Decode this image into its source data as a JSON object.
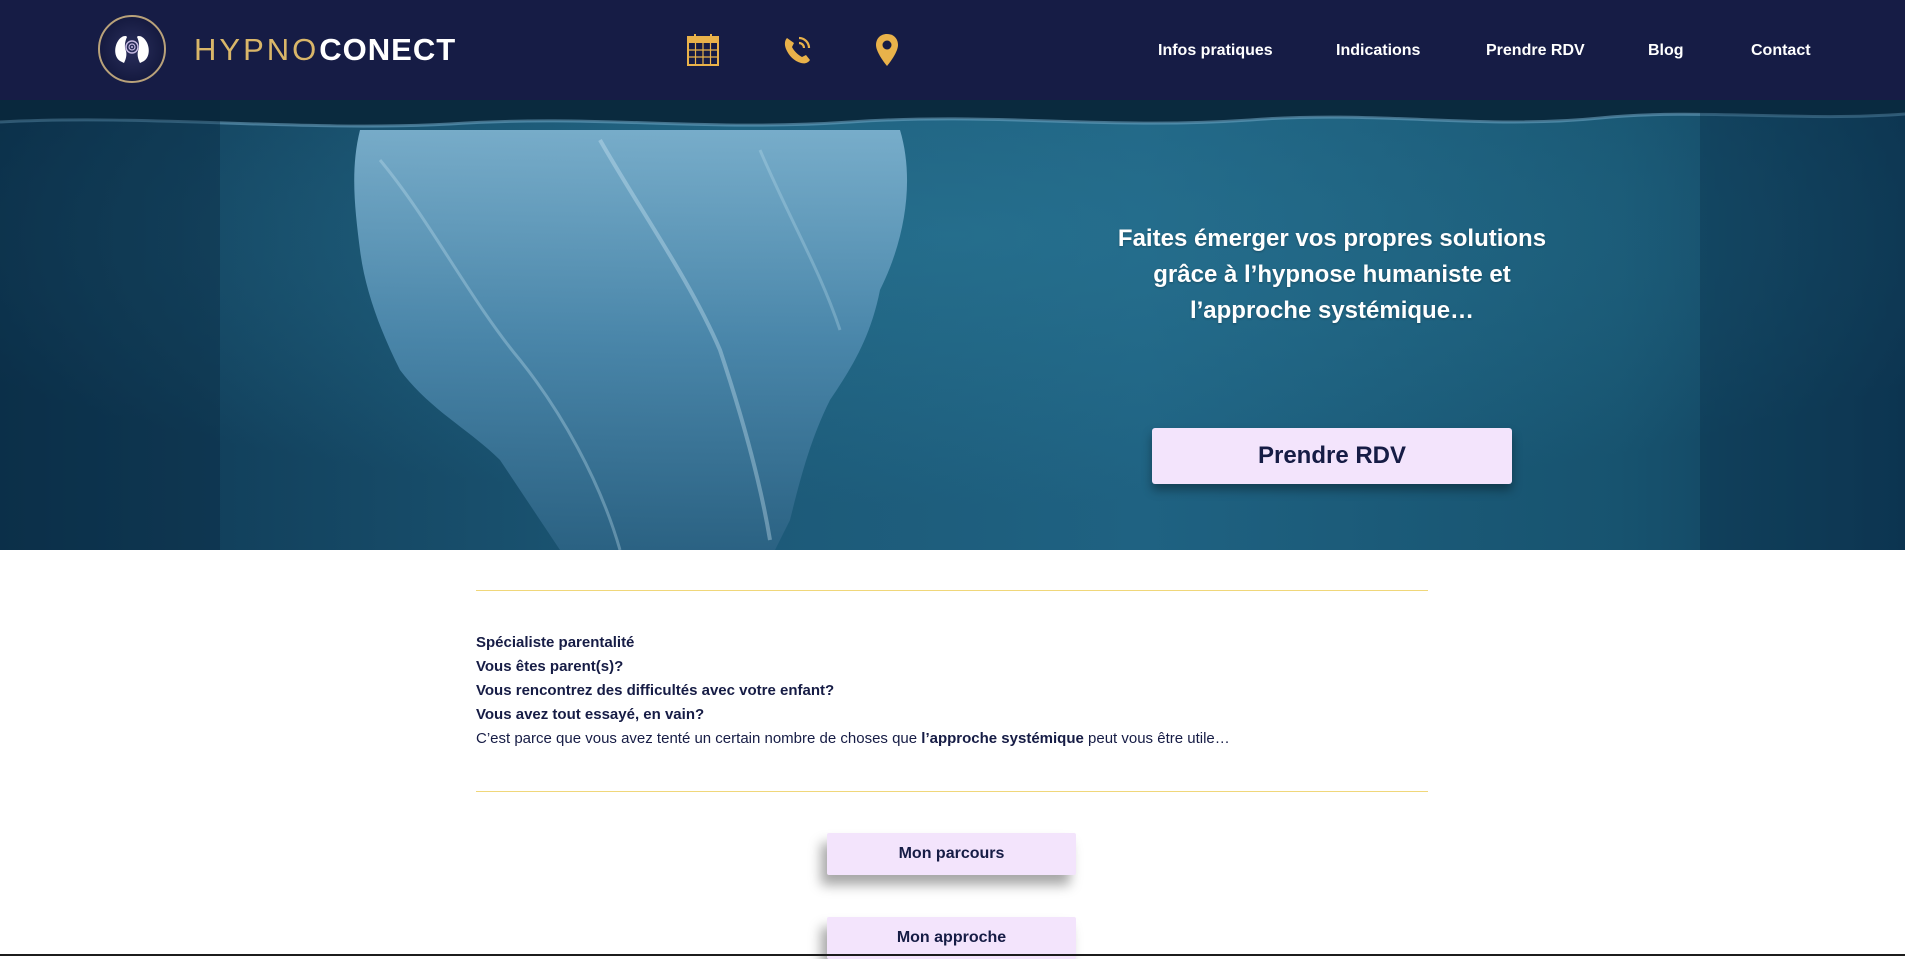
{
  "header": {
    "logo_text_light": "HYPNO",
    "logo_text_bold": "CONECT",
    "icons": [
      "calendar-icon",
      "phone-icon",
      "location-pin-icon"
    ],
    "nav": [
      "Infos pratiques",
      "Indications",
      "Prendre RDV",
      "Blog",
      "Contact"
    ]
  },
  "hero": {
    "tagline_line1": "Faites émerger vos propres solutions",
    "tagline_line2": "grâce à l’hypnose humaniste et",
    "tagline_line3": "l’approche systémique…",
    "cta_label": "Prendre RDV"
  },
  "intro": {
    "line1": "Spécialiste parentalité",
    "line2": "Vous êtes parent(s)?",
    "line3": "Vous rencontrez des difficultés avec votre enfant?",
    "line4": "Vous avez tout essayé, en vain?",
    "line5_before": "C’est parce que vous avez tenté un certain nombre de choses que ",
    "line5_strong": "l’approche systémique",
    "line5_after": " peut vous être utile…"
  },
  "buttons": {
    "parcours": "Mon parcours",
    "approche": "Mon approche"
  },
  "colors": {
    "header_bg": "#161c45",
    "accent_gold": "#e9b24a",
    "button_bg": "#f3e4fc",
    "divider": "#f0d77a"
  }
}
